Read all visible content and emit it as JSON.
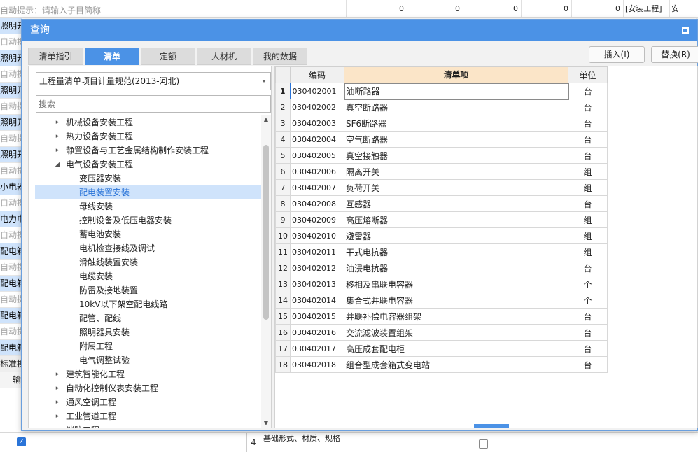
{
  "background": {
    "hint": "自动提示：请输入子目简称",
    "values": [
      "0",
      "0",
      "0",
      "0",
      "0"
    ],
    "tag": "[安装工程]",
    "tag2": "安",
    "left_rows": [
      "照明开",
      "自动提",
      "照明开",
      "自动提",
      "照明开",
      "自动提",
      "照明开",
      "自动提",
      "照明开",
      "自动提",
      "小电器",
      "自动提",
      "电力电",
      "自动提",
      "配电箱",
      "自动提",
      "配电箱",
      "自动提",
      "配电箱",
      "自动提",
      "配电箱",
      "标准换",
      "输"
    ],
    "bottom_num": "4",
    "bottom_text": "基础形式、材质、规格",
    "check_mark": "✓"
  },
  "dialog": {
    "title": "查询",
    "tabs": [
      "清单指引",
      "清单",
      "定额",
      "人材机",
      "我的数据"
    ],
    "active_tab": 1,
    "insert_label": "插入(I)",
    "replace_label": "替换(R)"
  },
  "left": {
    "spec_selected": "工程量清单项目计量规范(2013-河北)",
    "search_placeholder": "搜索",
    "tree": [
      {
        "label": "机械设备安装工程",
        "arrow": "▸"
      },
      {
        "label": "热力设备安装工程",
        "arrow": "▸"
      },
      {
        "label": "静置设备与工艺金属结构制作安装工程",
        "arrow": "▸"
      },
      {
        "label": "电气设备安装工程",
        "arrow": "◢"
      },
      {
        "label": "变压器安装"
      },
      {
        "label": "配电装置安装"
      },
      {
        "label": "母线安装"
      },
      {
        "label": "控制设备及低压电器安装"
      },
      {
        "label": "蓄电池安装"
      },
      {
        "label": "电机检查接线及调试"
      },
      {
        "label": "滑触线装置安装"
      },
      {
        "label": "电缆安装"
      },
      {
        "label": "防雷及接地装置"
      },
      {
        "label": "10kV以下架空配电线路"
      },
      {
        "label": "配管、配线"
      },
      {
        "label": "照明器具安装"
      },
      {
        "label": "附属工程"
      },
      {
        "label": "电气调整试验"
      },
      {
        "label": "建筑智能化工程",
        "arrow": "▸"
      },
      {
        "label": "自动化控制仪表安装工程",
        "arrow": "▸"
      },
      {
        "label": "通风空调工程",
        "arrow": "▸"
      },
      {
        "label": "工业管道工程",
        "arrow": "▸"
      },
      {
        "label": "消防工程",
        "arrow": "▸"
      }
    ],
    "selected_index": 5
  },
  "grid": {
    "headers": [
      "编码",
      "清单项",
      "单位"
    ],
    "rows": [
      {
        "no": "1",
        "code": "030402001",
        "name": "油断路器",
        "unit": "台"
      },
      {
        "no": "2",
        "code": "030402002",
        "name": "真空断路器",
        "unit": "台"
      },
      {
        "no": "3",
        "code": "030402003",
        "name": "SF6断路器",
        "unit": "台"
      },
      {
        "no": "4",
        "code": "030402004",
        "name": "空气断路器",
        "unit": "台"
      },
      {
        "no": "5",
        "code": "030402005",
        "name": "真空接触器",
        "unit": "台"
      },
      {
        "no": "6",
        "code": "030402006",
        "name": "隔离开关",
        "unit": "组"
      },
      {
        "no": "7",
        "code": "030402007",
        "name": "负荷开关",
        "unit": "组"
      },
      {
        "no": "8",
        "code": "030402008",
        "name": "互感器",
        "unit": "台"
      },
      {
        "no": "9",
        "code": "030402009",
        "name": "高压熔断器",
        "unit": "组"
      },
      {
        "no": "10",
        "code": "030402010",
        "name": "避雷器",
        "unit": "组"
      },
      {
        "no": "11",
        "code": "030402011",
        "name": "干式电抗器",
        "unit": "组"
      },
      {
        "no": "12",
        "code": "030402012",
        "name": "油浸电抗器",
        "unit": "台"
      },
      {
        "no": "13",
        "code": "030402013",
        "name": "移相及串联电容器",
        "unit": "个"
      },
      {
        "no": "14",
        "code": "030402014",
        "name": "集合式并联电容器",
        "unit": "个"
      },
      {
        "no": "15",
        "code": "030402015",
        "name": "并联补偿电容器组架",
        "unit": "台"
      },
      {
        "no": "16",
        "code": "030402016",
        "name": "交流滤波装置组架",
        "unit": "台"
      },
      {
        "no": "17",
        "code": "030402017",
        "name": "高压成套配电柜",
        "unit": "台"
      },
      {
        "no": "18",
        "code": "030402018",
        "name": "组合型成套箱式变电站",
        "unit": "台"
      }
    ],
    "splitter_glyph": "⌃"
  }
}
